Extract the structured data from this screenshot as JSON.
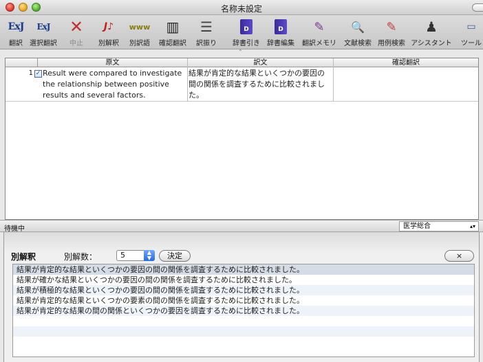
{
  "window": {
    "title": "名称未設定"
  },
  "toolbar": {
    "items": [
      {
        "label": "翻訳",
        "icon": "exj-translate-icon",
        "glyph": "ExJ"
      },
      {
        "label": "選択翻訳",
        "icon": "exj-select-translate-icon",
        "glyph": "ExJ"
      },
      {
        "label": "中止",
        "icon": "stop-x-icon",
        "glyph": "✕"
      },
      {
        "label": "別解釈",
        "icon": "alt-interpretation-icon",
        "glyph": "J♪"
      },
      {
        "label": "別訳語",
        "icon": "alt-words-icon",
        "glyph": "www"
      },
      {
        "label": "確認翻訳",
        "icon": "columns-icon",
        "glyph": "▥"
      },
      {
        "label": "訳振り",
        "icon": "lines-icon",
        "glyph": "☰"
      },
      {
        "label": "辞書引き",
        "icon": "dictionary-icon",
        "glyph": "D"
      },
      {
        "label": "辞書編集",
        "icon": "dictionary-edit-icon",
        "glyph": "D"
      },
      {
        "label": "翻訳メモリ",
        "icon": "translation-memory-icon",
        "glyph": "✎"
      },
      {
        "label": "文献検索",
        "icon": "magnifier-icon",
        "glyph": "🔍"
      },
      {
        "label": "用例検索",
        "icon": "example-search-icon",
        "glyph": "✎"
      },
      {
        "label": "アシスタント",
        "icon": "assistant-icon",
        "glyph": "♟"
      },
      {
        "label": "ツール",
        "icon": "tool-icon",
        "glyph": "▭"
      }
    ]
  },
  "table": {
    "headers": [
      "原文",
      "訳文",
      "確認翻訳"
    ],
    "rows": [
      {
        "number": "1",
        "checked": true,
        "source_lines": [
          "Result were compared to investigate",
          "the relationship between positive",
          "results and several factors."
        ],
        "target_lines": [
          "結果が肯定的な結果といくつかの要因の",
          "間の関係を調査するために比較されまし",
          "た。"
        ],
        "check": ""
      }
    ]
  },
  "status": {
    "text": "待機中",
    "dictionary": "医学総合"
  },
  "drawer": {
    "label": "別解釈",
    "count_label": "別解数：",
    "count_value": "5",
    "ok_label": "決定",
    "close_label": "×",
    "alternatives": [
      "結果が肯定的な結果といくつかの要因の間の関係を調査するために比較されました。",
      "結果が確かな結果といくつかの要因の間の関係を調査するために比較されました。",
      "結果が積極的な結果といくつかの要因の間の関係を調査するために比較されました。",
      "結果が肯定的な結果といくつかの要素の間の関係を調査するために比較されました。",
      "結果が肯定的な結果の間の関係といくつかの要因を調査するために比較されました。"
    ]
  }
}
